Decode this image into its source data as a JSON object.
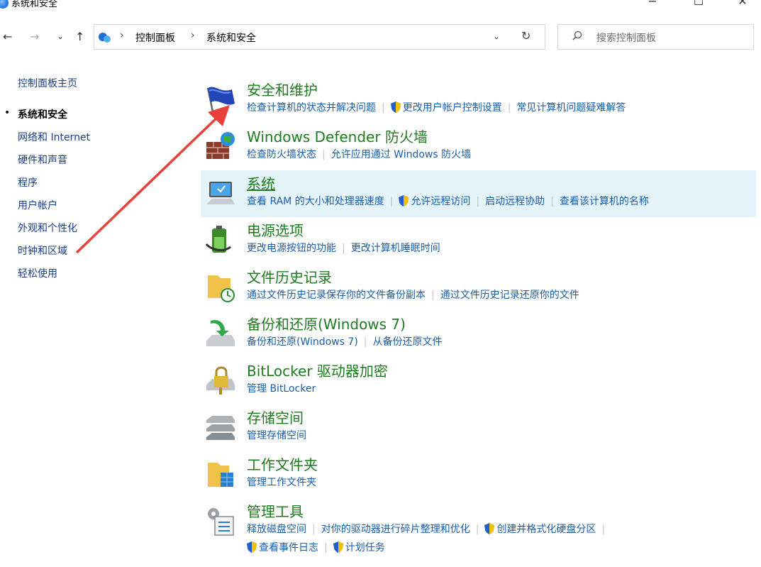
{
  "window": {
    "title": "系统和安全",
    "minimize": "−",
    "maximize": "☐",
    "close": "✕"
  },
  "nav": {
    "back": "←",
    "forward": "→",
    "recent": "⌄",
    "up": "↑"
  },
  "address": {
    "crumbs": [
      "控制面板",
      "系统和安全"
    ],
    "separator": "›",
    "dropdown": "⌄",
    "refresh": "↻"
  },
  "search": {
    "placeholder": "搜索控制面板"
  },
  "sidebar": {
    "home": "控制面板主页",
    "bullet": "•",
    "items": [
      {
        "label": "系统和安全",
        "current": true
      },
      {
        "label": "网络和 Internet"
      },
      {
        "label": "硬件和声音"
      },
      {
        "label": "程序"
      },
      {
        "label": "用户帐户"
      },
      {
        "label": "外观和个性化"
      },
      {
        "label": "时钟和区域"
      },
      {
        "label": "轻松使用"
      }
    ]
  },
  "categories": [
    {
      "title": "安全和维护",
      "icon": "flag-icon",
      "links": [
        "检查计算机的状态并解决问题",
        "更改用户帐户控制设置",
        "常见计算机问题疑难解答"
      ]
    },
    {
      "title": "Windows Defender 防火墙",
      "icon": "firewall-icon",
      "links": [
        "检查防火墙状态",
        "允许应用通过 Windows 防火墙"
      ]
    },
    {
      "title": "系统",
      "icon": "computer-icon",
      "links": [
        "查看 RAM 的大小和处理器速度",
        "允许远程访问",
        "启动远程协助",
        "查看该计算机的名称"
      ]
    },
    {
      "title": "电源选项",
      "icon": "battery-icon",
      "links": [
        "更改电源按钮的功能",
        "更改计算机睡眠时间"
      ]
    },
    {
      "title": "文件历史记录",
      "icon": "file-history-icon",
      "links": [
        "通过文件历史记录保存你的文件备份副本",
        "通过文件历史记录还原你的文件"
      ]
    },
    {
      "title": "备份和还原(Windows 7)",
      "icon": "backup-icon",
      "links": [
        "备份和还原(Windows 7)",
        "从备份还原文件"
      ]
    },
    {
      "title": "BitLocker 驱动器加密",
      "icon": "bitlocker-icon",
      "links": [
        "管理 BitLocker"
      ]
    },
    {
      "title": "存储空间",
      "icon": "storage-icon",
      "links": [
        "管理存储空间"
      ]
    },
    {
      "title": "工作文件夹",
      "icon": "work-folders-icon",
      "links": [
        "管理工作文件夹"
      ]
    },
    {
      "title": "管理工具",
      "icon": "admin-tools-icon",
      "links": [
        "释放磁盘空间",
        "对你的驱动器进行碎片整理和优化",
        "创建并格式化硬盘分区",
        "查看事件日志",
        "计划任务"
      ]
    }
  ],
  "colors": {
    "title_green": "#1e7b1e",
    "link_blue": "#1a5ea8",
    "highlight": "#e5f3fb",
    "arrow": "#e8403a"
  }
}
